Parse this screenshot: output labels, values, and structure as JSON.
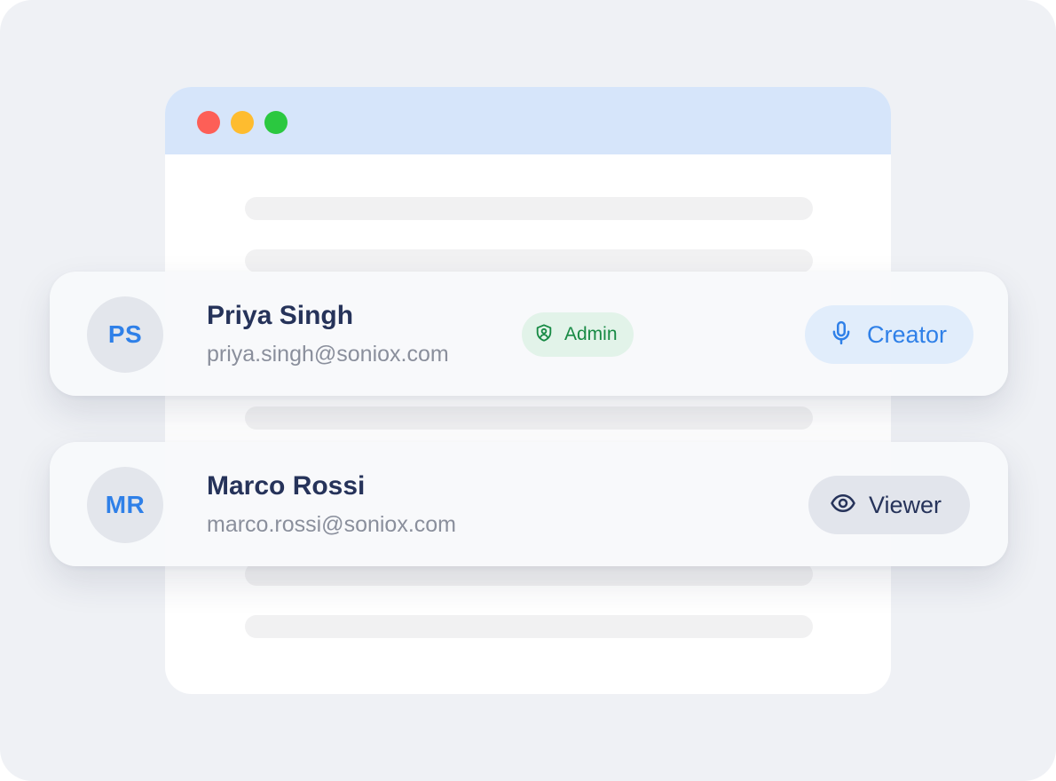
{
  "window": {
    "controls": [
      "close",
      "minimize",
      "maximize"
    ]
  },
  "users": [
    {
      "initials": "PS",
      "name": "Priya Singh",
      "email": "priya.singh@soniox.com",
      "badge": {
        "label": "Admin",
        "icon": "shield-icon",
        "color": "#178a44"
      },
      "role": {
        "label": "Creator",
        "icon": "microphone-icon",
        "color": "#2f80e8"
      }
    },
    {
      "initials": "MR",
      "name": "Marco Rossi",
      "email": "marco.rossi@soniox.com",
      "role": {
        "label": "Viewer",
        "icon": "eye-icon",
        "color": "#26335a"
      }
    }
  ],
  "colors": {
    "accent": "#2f80e8",
    "name_text": "#26335a",
    "email_text": "#8a8f9c",
    "titlebar": "#d6e5fa"
  }
}
